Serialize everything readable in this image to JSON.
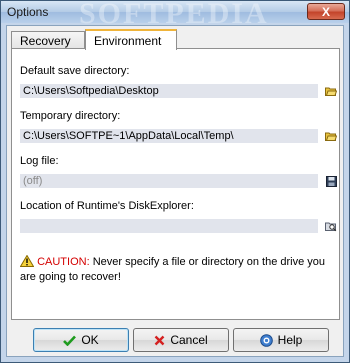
{
  "window": {
    "title": "Options",
    "close_label": "X",
    "watermark": "SOFTPEDIA"
  },
  "tabs": [
    {
      "label": "Recovery"
    },
    {
      "label": "Environment"
    }
  ],
  "environment": {
    "default_save_dir": {
      "label": "Default save directory:",
      "value": "C:\\Users\\Softpedia\\Desktop"
    },
    "temp_dir": {
      "label": "Temporary directory:",
      "value": "C:\\Users\\SOFTPE~1\\AppData\\Local\\Temp\\"
    },
    "log_file": {
      "label": "Log file:",
      "value": "(off)"
    },
    "diskexplorer": {
      "label": "Location of Runtime's DiskExplorer:",
      "value": ""
    },
    "caution": {
      "prefix": "CAUTION:",
      "text": "Never specify a file or directory on the drive you are going to recover!"
    }
  },
  "buttons": {
    "ok": "OK",
    "cancel": "Cancel",
    "help": "Help"
  },
  "colors": {
    "window_bg": "#c4d5ea",
    "field_bg": "#e1e4ec",
    "tab_accent": "#f0b43a",
    "warning": "#d40000"
  }
}
